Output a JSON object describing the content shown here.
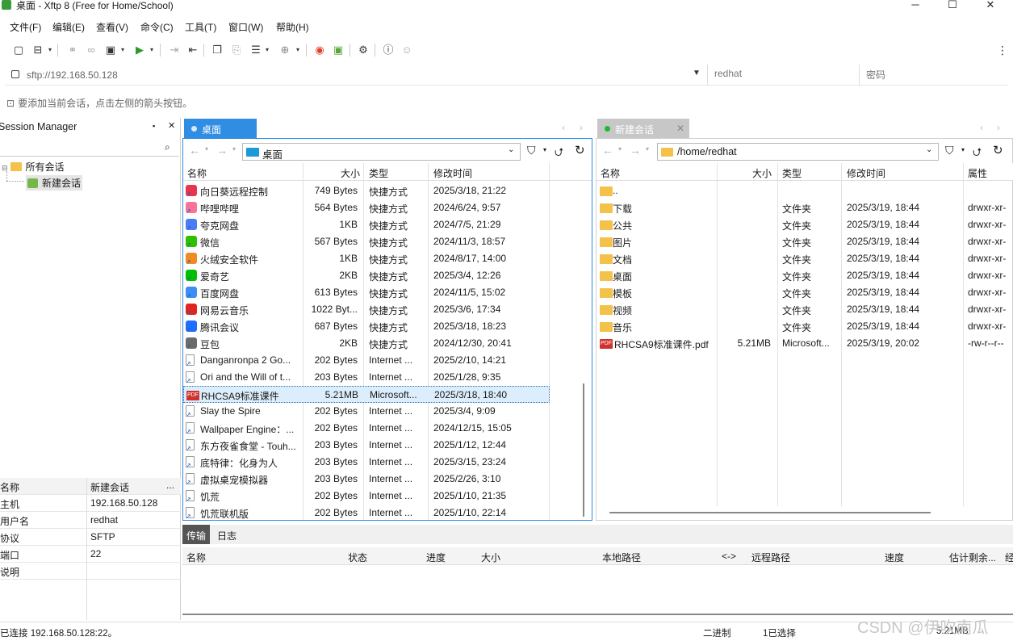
{
  "window": {
    "title": "桌面 - Xftp 8 (Free for Home/School)",
    "minimize": "─",
    "maximize": "☐",
    "close": "✕"
  },
  "menu": [
    "文件(F)",
    "编辑(E)",
    "查看(V)",
    "命令(C)",
    "工具(T)",
    "窗口(W)",
    "帮助(H)"
  ],
  "address": {
    "url": "sftp://192.168.50.128",
    "user_placeholder": "redhat",
    "password_placeholder": "密码"
  },
  "hint": "要添加当前会话，点击左侧的箭头按钮。",
  "session_manager": {
    "title": "Session Manager",
    "pin": "📌",
    "close": "✕",
    "tree_root": "所有会话",
    "tree_child": "新建会话",
    "props": [
      {
        "k": "名称",
        "v": "新建会话"
      },
      {
        "k": "主机",
        "v": "192.168.50.128"
      },
      {
        "k": "用户名",
        "v": "redhat"
      },
      {
        "k": "协议",
        "v": "SFTP"
      },
      {
        "k": "端口",
        "v": "22"
      },
      {
        "k": "说明",
        "v": ""
      }
    ],
    "props_more": "..."
  },
  "left_pane": {
    "tab": "桌面",
    "path": "桌面",
    "headers": {
      "name": "名称",
      "size": "大小",
      "type": "类型",
      "mtime": "修改时间"
    },
    "rows": [
      {
        "name": "向日葵远程控制",
        "size": "749 Bytes",
        "type": "快捷方式",
        "mtime": "2025/3/18, 21:22",
        "color": "#e8344f"
      },
      {
        "name": "哔哩哔哩",
        "size": "564 Bytes",
        "type": "快捷方式",
        "mtime": "2024/6/24, 9:57",
        "color": "#fb7299"
      },
      {
        "name": "夸克网盘",
        "size": "1KB",
        "type": "快捷方式",
        "mtime": "2024/7/5, 21:29",
        "color": "#4a7cf6"
      },
      {
        "name": "微信",
        "size": "567 Bytes",
        "type": "快捷方式",
        "mtime": "2024/11/3, 18:57",
        "color": "#2dc100"
      },
      {
        "name": "火绒安全软件",
        "size": "1KB",
        "type": "快捷方式",
        "mtime": "2024/8/17, 14:00",
        "color": "#f08a24"
      },
      {
        "name": "爱奇艺",
        "size": "2KB",
        "type": "快捷方式",
        "mtime": "2025/3/4, 12:26",
        "color": "#00be06"
      },
      {
        "name": "百度网盘",
        "size": "613 Bytes",
        "type": "快捷方式",
        "mtime": "2024/11/5, 15:02",
        "color": "#3a8ef6"
      },
      {
        "name": "网易云音乐",
        "size": "1022 Byt...",
        "type": "快捷方式",
        "mtime": "2025/3/6, 17:34",
        "color": "#e02424"
      },
      {
        "name": "腾讯会议",
        "size": "687 Bytes",
        "type": "快捷方式",
        "mtime": "2025/3/18, 18:23",
        "color": "#1e6fff"
      },
      {
        "name": "豆包",
        "size": "2KB",
        "type": "快捷方式",
        "mtime": "2024/12/30, 20:41",
        "color": "#6b6b6b"
      },
      {
        "name": "Danganronpa 2 Go...",
        "size": "202 Bytes",
        "type": "Internet ...",
        "mtime": "2025/2/10, 14:21",
        "color": "#ffffff"
      },
      {
        "name": "Ori and the Will of t...",
        "size": "203 Bytes",
        "type": "Internet ...",
        "mtime": "2025/1/28, 9:35",
        "color": "#ffffff"
      },
      {
        "name": "RHCSA9标准课件",
        "size": "5.21MB",
        "type": "Microsoft...",
        "mtime": "2025/3/18, 18:40",
        "color": "#d0312d",
        "pdf": "PDF",
        "selected": true
      },
      {
        "name": "Slay the Spire",
        "size": "202 Bytes",
        "type": "Internet ...",
        "mtime": "2025/3/4, 9:09",
        "color": "#ffffff"
      },
      {
        "name": "Wallpaper Engine：...",
        "size": "202 Bytes",
        "type": "Internet ...",
        "mtime": "2024/12/15, 15:05",
        "color": "#ffffff"
      },
      {
        "name": "东方夜雀食堂 - Touh...",
        "size": "203 Bytes",
        "type": "Internet ...",
        "mtime": "2025/1/12, 12:44",
        "color": "#ffffff"
      },
      {
        "name": "底特律：化身为人",
        "size": "203 Bytes",
        "type": "Internet ...",
        "mtime": "2025/3/15, 23:24",
        "color": "#ffffff"
      },
      {
        "name": "虚拟桌宠模拟器",
        "size": "203 Bytes",
        "type": "Internet ...",
        "mtime": "2025/2/26, 3:10",
        "color": "#ffffff"
      },
      {
        "name": "饥荒",
        "size": "202 Bytes",
        "type": "Internet ...",
        "mtime": "2025/1/10, 21:35",
        "color": "#ffffff"
      },
      {
        "name": "饥荒联机版",
        "size": "202 Bytes",
        "type": "Internet ...",
        "mtime": "2025/1/10, 22:14",
        "color": "#ffffff"
      }
    ]
  },
  "right_pane": {
    "tab": "新建会话",
    "path": "/home/redhat",
    "headers": {
      "name": "名称",
      "size": "大小",
      "type": "类型",
      "mtime": "修改时间",
      "attr": "属性"
    },
    "rows": [
      {
        "name": "..",
        "size": "",
        "type": "",
        "mtime": "",
        "attr": ""
      },
      {
        "name": "下载",
        "size": "",
        "type": "文件夹",
        "mtime": "2025/3/19, 18:44",
        "attr": "drwxr-xr-"
      },
      {
        "name": "公共",
        "size": "",
        "type": "文件夹",
        "mtime": "2025/3/19, 18:44",
        "attr": "drwxr-xr-"
      },
      {
        "name": "图片",
        "size": "",
        "type": "文件夹",
        "mtime": "2025/3/19, 18:44",
        "attr": "drwxr-xr-"
      },
      {
        "name": "文档",
        "size": "",
        "type": "文件夹",
        "mtime": "2025/3/19, 18:44",
        "attr": "drwxr-xr-"
      },
      {
        "name": "桌面",
        "size": "",
        "type": "文件夹",
        "mtime": "2025/3/19, 18:44",
        "attr": "drwxr-xr-"
      },
      {
        "name": "模板",
        "size": "",
        "type": "文件夹",
        "mtime": "2025/3/19, 18:44",
        "attr": "drwxr-xr-"
      },
      {
        "name": "视频",
        "size": "",
        "type": "文件夹",
        "mtime": "2025/3/19, 18:44",
        "attr": "drwxr-xr-"
      },
      {
        "name": "音乐",
        "size": "",
        "type": "文件夹",
        "mtime": "2025/3/19, 18:44",
        "attr": "drwxr-xr-"
      },
      {
        "name": "RHCSA9标准课件.pdf",
        "size": "5.21MB",
        "type": "Microsoft...",
        "mtime": "2025/3/19, 20:02",
        "attr": "-rw-r--r--",
        "pdf": "PDF"
      }
    ]
  },
  "transfer": {
    "tabs": [
      "传输",
      "日志"
    ],
    "headers": [
      "名称",
      "状态",
      "进度",
      "大小",
      "本地路径",
      "<->",
      "远程路径",
      "速度",
      "估计剩余...",
      "经"
    ]
  },
  "status": {
    "connected": "已连接 192.168.50.128:22。",
    "mode": "二进制",
    "selected": "1已选择",
    "size": "5.21MB"
  },
  "watermark": "CSDN @伊吹南瓜"
}
